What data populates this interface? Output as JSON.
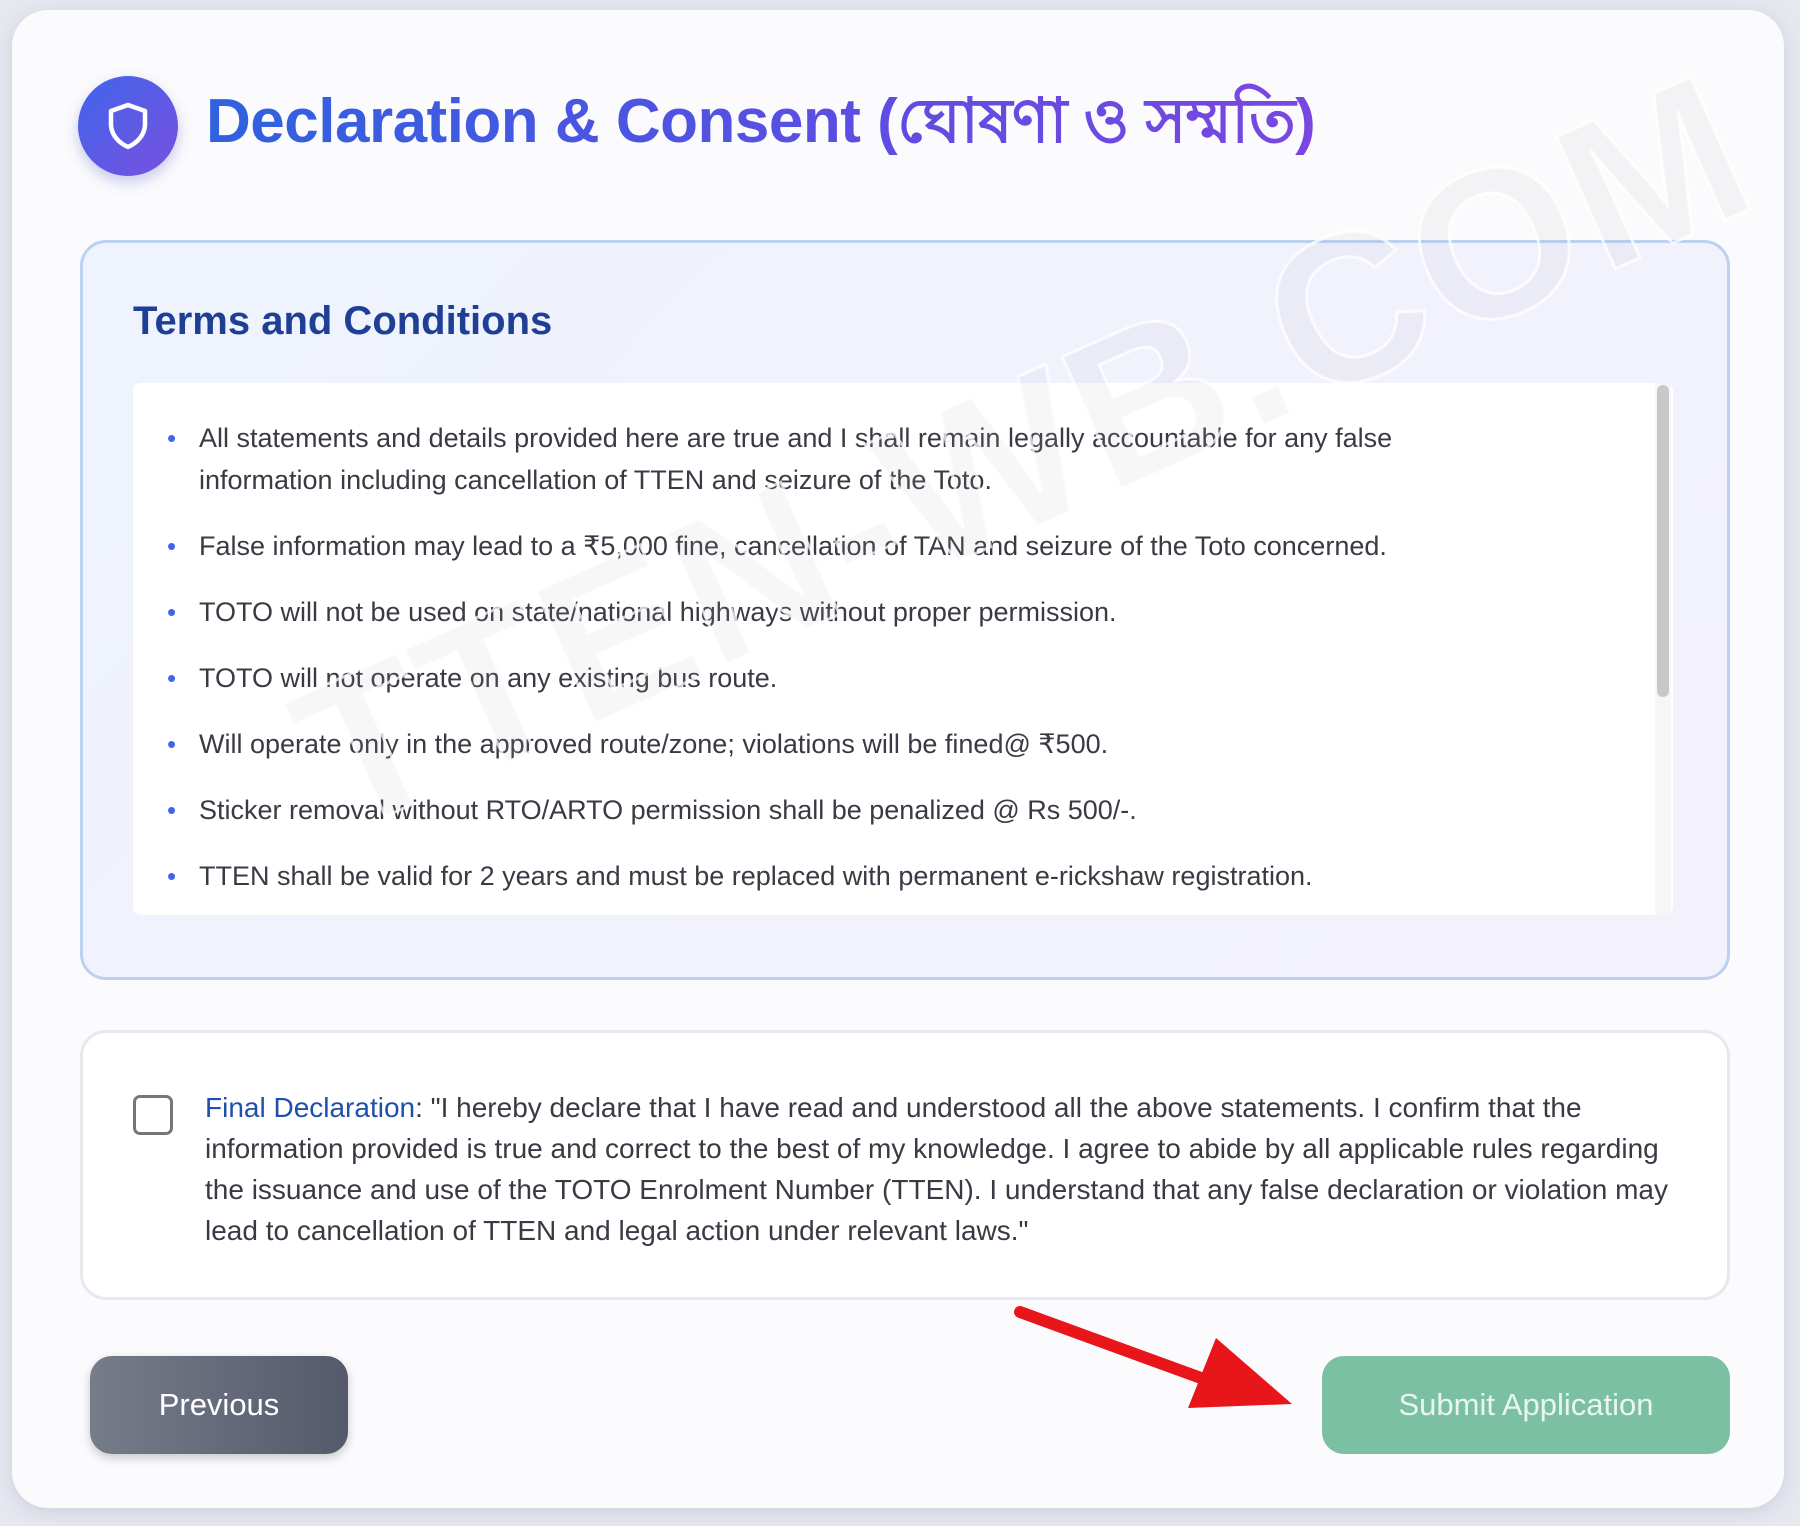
{
  "header": {
    "title": "Declaration & Consent (ঘোষণা ও সম্মতি)",
    "icon": "shield-icon"
  },
  "terms": {
    "title": "Terms and Conditions",
    "items": [
      "All statements and details provided here are true and I shall remain legally accountable for any false information including cancellation of TTEN and seizure of the Toto.",
      "False information may lead to a ₹5,000 fine, cancellation of TAN and seizure of the Toto concerned.",
      "TOTO will not be used on state/national highways without proper permission.",
      "TOTO will not operate on any existing bus route.",
      "Will operate only in the approved route/zone; violations will be fined@ ₹500.",
      "Sticker removal without RTO/ARTO permission shall be penalized @ Rs 500/-.",
      "TTEN shall be valid for 2 years and must be replaced with permanent e-rickshaw registration."
    ]
  },
  "declaration": {
    "label": "Final Declaration",
    "text": ": \"I hereby declare that I have read and understood all the above statements. I confirm that the information provided is true and correct to the best of my knowledge. I agree to abide by all applicable rules regarding the issuance and use of the TOTO Enrolment Number (TTEN). I understand that any false declaration or violation may lead to cancellation of TTEN and legal action under relevant laws.\"",
    "checked": false
  },
  "buttons": {
    "previous": "Previous",
    "submit": "Submit Application"
  },
  "watermark": "TTEN-WB.COM",
  "colors": {
    "title_gradient_start": "#2f62e0",
    "title_gradient_end": "#7a47e0",
    "terms_title": "#1f3f95",
    "submit_bg": "#7cc0a3",
    "previous_bg": "#5f6474",
    "annotation_arrow": "#e8161b"
  }
}
